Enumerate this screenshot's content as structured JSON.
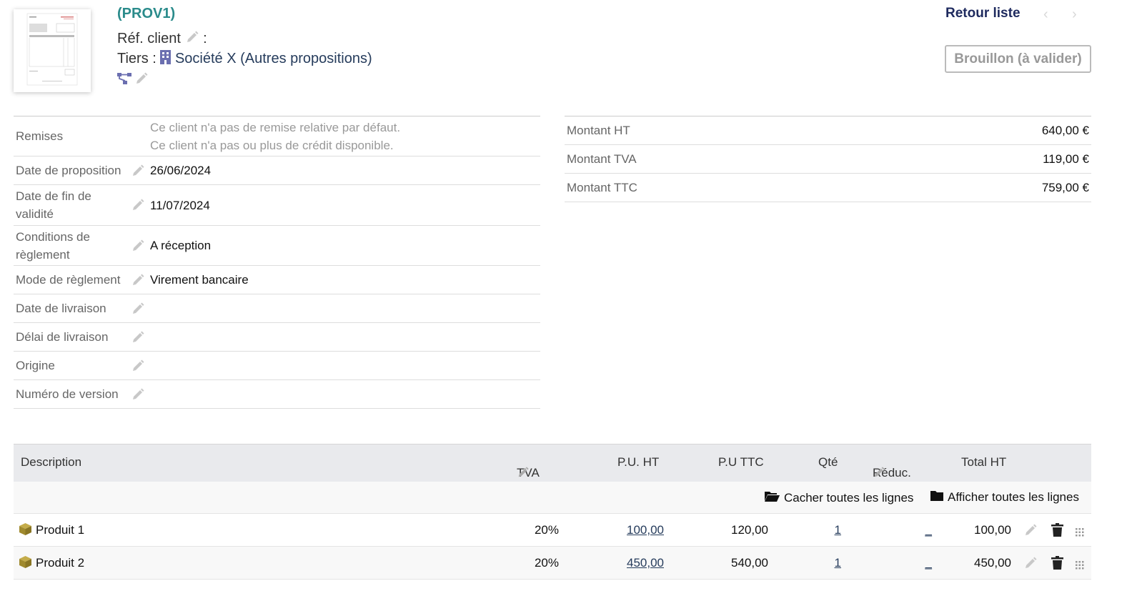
{
  "header": {
    "ref": "(PROV1)",
    "ref_client_label": "Réf. client",
    "ref_client_suffix": ":",
    "tiers_label": "Tiers :",
    "tiers_name": "Société X",
    "tiers_other": "(Autres propositions)",
    "back_label": "Retour liste",
    "prev_arrow": "‹",
    "next_arrow": "›",
    "status": "Brouillon (à valider)"
  },
  "fields": {
    "remises_label": "Remises",
    "remises_line1": "Ce client n'a pas de remise relative par défaut.",
    "remises_line2": "Ce client n'a pas ou plus de crédit disponible.",
    "date_prop_label": "Date de proposition",
    "date_prop_value": "26/06/2024",
    "date_fin_label": "Date de fin de validité",
    "date_fin_value": "11/07/2024",
    "conditions_label": "Conditions de règlement",
    "conditions_value": "A réception",
    "mode_label": "Mode de règlement",
    "mode_value": "Virement bancaire",
    "date_livraison_label": "Date de livraison",
    "delai_label": "Délai de livraison",
    "origine_label": "Origine",
    "version_label": "Numéro de version"
  },
  "amounts": {
    "ht_label": "Montant HT",
    "ht_value": "640,00 €",
    "tva_label": "Montant TVA",
    "tva_value": "119,00 €",
    "ttc_label": "Montant TTC",
    "ttc_value": "759,00 €"
  },
  "lines": {
    "headers": {
      "description": "Description",
      "tva": "TVA",
      "pu_ht": "P.U. HT",
      "pu_ttc": "P.U TTC",
      "qty": "Qté",
      "reduc": "Réduc.",
      "total_ht": "Total HT"
    },
    "hide_all": "Cacher toutes les lignes",
    "show_all": "Afficher toutes les lignes",
    "rows": [
      {
        "product": "Produit 1",
        "tva": "20%",
        "pu_ht": "100,00",
        "pu_ttc": "120,00",
        "qty": "1",
        "reduc": "_",
        "total_ht": "100,00"
      },
      {
        "product": "Produit 2",
        "tva": "20%",
        "pu_ht": "450,00",
        "pu_ttc": "540,00",
        "qty": "1",
        "reduc": "_",
        "total_ht": "450,00"
      }
    ]
  },
  "colors": {
    "ref": "#2a8b8b",
    "link": "#263c5c",
    "product_icon": "#a08a2e",
    "company_icon": "#6b6fb0"
  }
}
